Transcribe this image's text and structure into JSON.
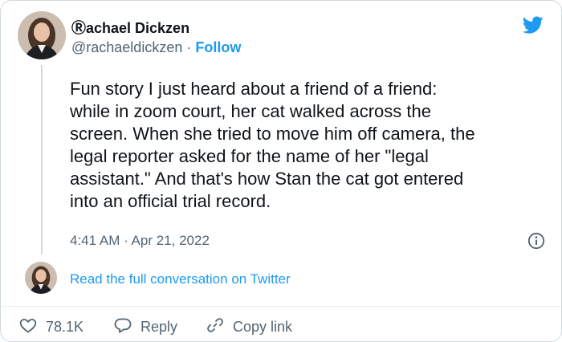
{
  "author": {
    "name": "Ⓡachael Dickzen",
    "handle": "@rachaeldickzen",
    "separator": "·",
    "follow_label": "Follow"
  },
  "tweet": {
    "text": "Fun story I just heard about a friend of a friend:\nwhile in zoom court, her cat walked across the\nscreen. When she tried to move him off camera, the\nlegal reporter asked for the name of her \"legal\nassistant.\" And that's how Stan the cat got entered\ninto an official trial record.",
    "timestamp": "4:41 AM · Apr 21, 2022"
  },
  "thread": {
    "read_full_label": "Read the full conversation on Twitter"
  },
  "actions": {
    "like_count": "78.1K",
    "reply_label": "Reply",
    "copy_link_label": "Copy link"
  },
  "icons": {
    "logo": "twitter-bird-icon",
    "info": "info-icon",
    "like": "heart-icon",
    "reply": "speech-bubble-icon",
    "copy_link": "link-icon"
  },
  "colors": {
    "brand": "#1d9bf0",
    "text": "#0f1419",
    "muted": "#536471",
    "border": "#cfd9de"
  }
}
